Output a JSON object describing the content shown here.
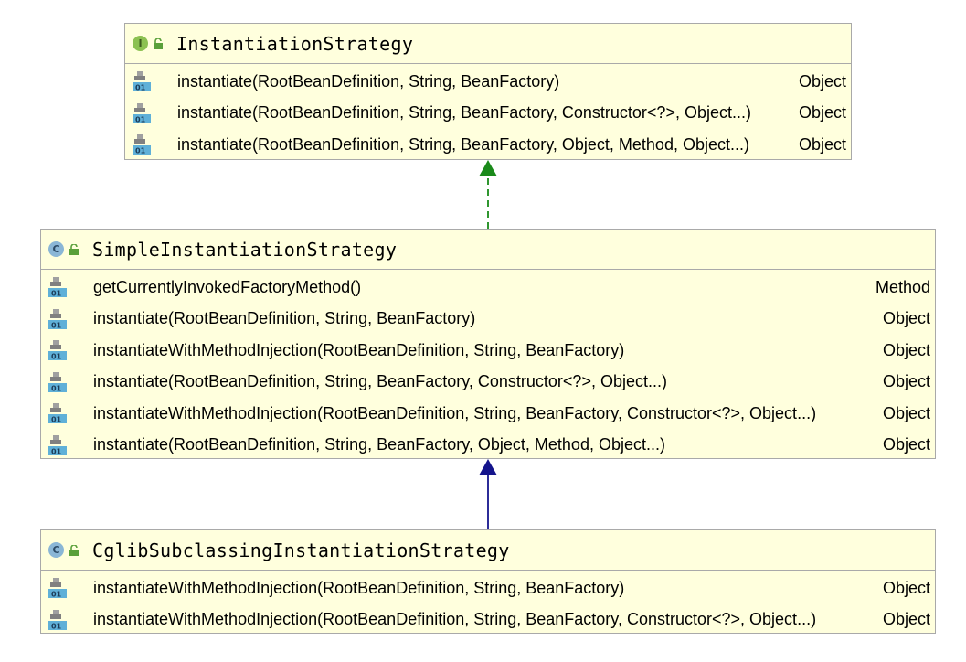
{
  "diagram": {
    "classes": [
      {
        "id": "instantiation-strategy",
        "kind": "I",
        "kind_type": "interface",
        "name": "InstantiationStrategy",
        "methods": [
          {
            "signature": "instantiate(RootBeanDefinition, String, BeanFactory)",
            "return_type": "Object"
          },
          {
            "signature": "instantiate(RootBeanDefinition, String, BeanFactory, Constructor<?>, Object...)",
            "return_type": "Object"
          },
          {
            "signature": "instantiate(RootBeanDefinition, String, BeanFactory, Object, Method, Object...)",
            "return_type": "Object"
          }
        ]
      },
      {
        "id": "simple-instantiation-strategy",
        "kind": "C",
        "kind_type": "class",
        "name": "SimpleInstantiationStrategy",
        "methods": [
          {
            "signature": "getCurrentlyInvokedFactoryMethod()",
            "return_type": "Method"
          },
          {
            "signature": "instantiate(RootBeanDefinition, String, BeanFactory)",
            "return_type": "Object"
          },
          {
            "signature": "instantiateWithMethodInjection(RootBeanDefinition, String, BeanFactory)",
            "return_type": "Object"
          },
          {
            "signature": "instantiate(RootBeanDefinition, String, BeanFactory, Constructor<?>, Object...)",
            "return_type": "Object"
          },
          {
            "signature": "instantiateWithMethodInjection(RootBeanDefinition, String, BeanFactory, Constructor<?>, Object...)",
            "return_type": "Object"
          },
          {
            "signature": "instantiate(RootBeanDefinition, String, BeanFactory, Object, Method, Object...)",
            "return_type": "Object"
          }
        ]
      },
      {
        "id": "cglib-subclassing-instantiation-strategy",
        "kind": "C",
        "kind_type": "class",
        "name": "CglibSubclassingInstantiationStrategy",
        "methods": [
          {
            "signature": "instantiateWithMethodInjection(RootBeanDefinition, String, BeanFactory)",
            "return_type": "Object"
          },
          {
            "signature": "instantiateWithMethodInjection(RootBeanDefinition, String, BeanFactory, Constructor<?>, Object...)",
            "return_type": "Object"
          }
        ]
      }
    ],
    "relations": [
      {
        "from": "simple-instantiation-strategy",
        "to": "instantiation-strategy",
        "type": "implements",
        "style": "dashed",
        "color": "#1a8a1a"
      },
      {
        "from": "cglib-subclassing-instantiation-strategy",
        "to": "simple-instantiation-strategy",
        "type": "extends",
        "style": "solid",
        "color": "#14148c"
      }
    ],
    "colors": {
      "box_fill": "#ffffdd",
      "box_border": "#a9a9a9",
      "interface_badge": "#8cc152",
      "class_badge": "#8ab6d6",
      "implements_arrow": "#1a8a1a",
      "extends_arrow": "#14148c"
    },
    "icons": {
      "interface_kind": "interface-i-icon",
      "class_kind": "class-c-icon",
      "visibility": "public-lock-icon",
      "method": "method-01-icon"
    }
  }
}
